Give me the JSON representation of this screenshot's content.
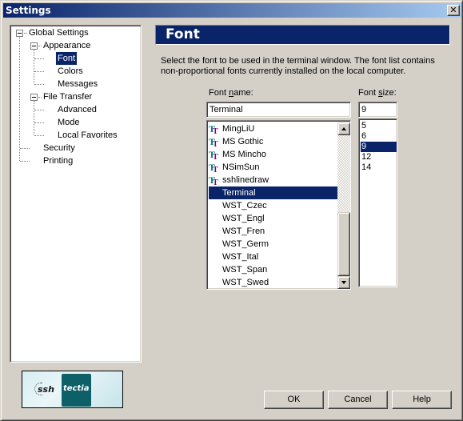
{
  "window": {
    "title": "Settings",
    "close_label": "✕"
  },
  "tree": {
    "global_settings": "Global Settings",
    "appearance": "Appearance",
    "font": "Font",
    "colors": "Colors",
    "messages": "Messages",
    "file_transfer": "File Transfer",
    "advanced": "Advanced",
    "mode": "Mode",
    "local_favorites": "Local Favorites",
    "security": "Security",
    "printing": "Printing",
    "selected": "Font"
  },
  "page": {
    "header": "Font",
    "description": "Select the font to be used in the terminal window. The font list contains non-proportional fonts currently installed on the local computer.",
    "font_name_label_pre": "Font ",
    "font_name_label_accel": "n",
    "font_name_label_post": "ame:",
    "font_size_label_pre": "Font ",
    "font_size_label_accel": "s",
    "font_size_label_post": "ize:",
    "font_name_value": "Terminal",
    "font_size_value": "9",
    "font_list": [
      {
        "name": "MingLiU",
        "icon": "truetype-icon"
      },
      {
        "name": "MS Gothic",
        "icon": "truetype-icon"
      },
      {
        "name": "MS Mincho",
        "icon": "truetype-icon"
      },
      {
        "name": "NSimSun",
        "icon": "truetype-icon"
      },
      {
        "name": "sshlinedraw",
        "icon": "truetype-icon"
      },
      {
        "name": "Terminal",
        "icon": null
      },
      {
        "name": "WST_Czec",
        "icon": null
      },
      {
        "name": "WST_Engl",
        "icon": null
      },
      {
        "name": "WST_Fren",
        "icon": null
      },
      {
        "name": "WST_Germ",
        "icon": null
      },
      {
        "name": "WST_Ital",
        "icon": null
      },
      {
        "name": "WST_Span",
        "icon": null
      },
      {
        "name": "WST_Swed",
        "icon": null
      }
    ],
    "selected_font": "Terminal",
    "size_list": [
      "5",
      "6",
      "9",
      "12",
      "14"
    ],
    "selected_size": "9"
  },
  "logo": {
    "ssh": "ssh",
    "tectia": "tectia"
  },
  "buttons": {
    "ok": "OK",
    "cancel": "Cancel",
    "help": "Help"
  },
  "colors": {
    "selection": "#0a246a",
    "titlebar_start": "#0a246a",
    "titlebar_end": "#a6caf0",
    "face": "#d4d0c8",
    "logo_teal": "#0e6068",
    "tt_teal": "#008080",
    "tt_purple": "#800080"
  }
}
